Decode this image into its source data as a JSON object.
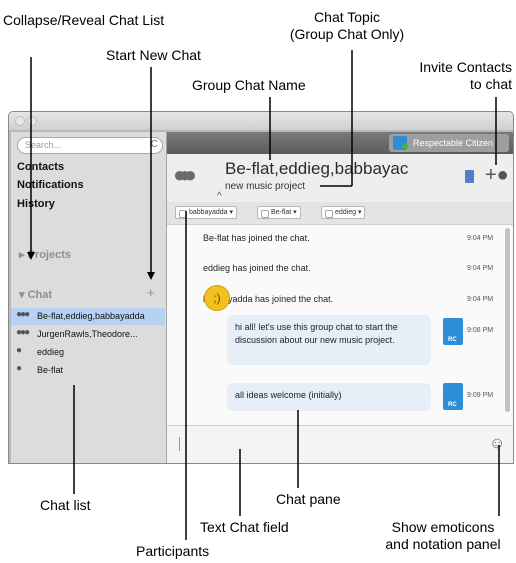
{
  "callouts": {
    "collapse": "Collapse/Reveal Chat List",
    "start_new_chat": "Start New Chat",
    "chat_topic_line1": "Chat Topic",
    "chat_topic_line2": "(Group Chat Only)",
    "group_chat_name": "Group Chat Name",
    "invite_line1": "Invite Contacts",
    "invite_line2": "to chat",
    "chat_list": "Chat list",
    "chat_pane": "Chat pane",
    "text_chat_field": "Text Chat field",
    "show_emoticons_line1": "Show emoticons",
    "show_emoticons_line2": "and notation panel",
    "participants": "Participants"
  },
  "sidebar": {
    "search_placeholder": "Search...",
    "nav": [
      "Contacts",
      "Notifications",
      "History"
    ],
    "projects": "▸ Projects",
    "chat_header": "▾ Chat",
    "chats": [
      {
        "label": "Be-flat,eddieg,babbayadda",
        "icon": "group-icon",
        "selected": true
      },
      {
        "label": "JurgenRawls,Theodore...",
        "icon": "group-icon",
        "selected": false
      },
      {
        "label": "eddieg",
        "icon": "person-icon",
        "selected": false
      },
      {
        "label": "Be-flat",
        "icon": "person-icon",
        "selected": false
      }
    ]
  },
  "status": {
    "user": "Respectable Citizen"
  },
  "header": {
    "group_name": "Be-flat,eddieg,babbayac",
    "topic": "new music project"
  },
  "participants": [
    "babbayadda ▾",
    "Be-flat ▾",
    "eddieg ▾"
  ],
  "messages": [
    {
      "text": "Be-flat has joined the chat.",
      "time": "9:04 PM"
    },
    {
      "text": "eddieg has joined the chat.",
      "time": "9:04 PM"
    },
    {
      "text": "babbayadda has joined the chat.",
      "time": "9:04 PM"
    },
    {
      "text": "hi all! let's use this group chat to start the discussion about our new music project.",
      "time": "9:08 PM",
      "avatar": "RC"
    },
    {
      "text": "all ideas welcome (initially)",
      "time": "9:09 PM",
      "avatar": "RC"
    }
  ],
  "colors": {
    "selection": "#b6d1f2",
    "accent": "#2c8fd6",
    "bubble": "#e6eef8"
  }
}
